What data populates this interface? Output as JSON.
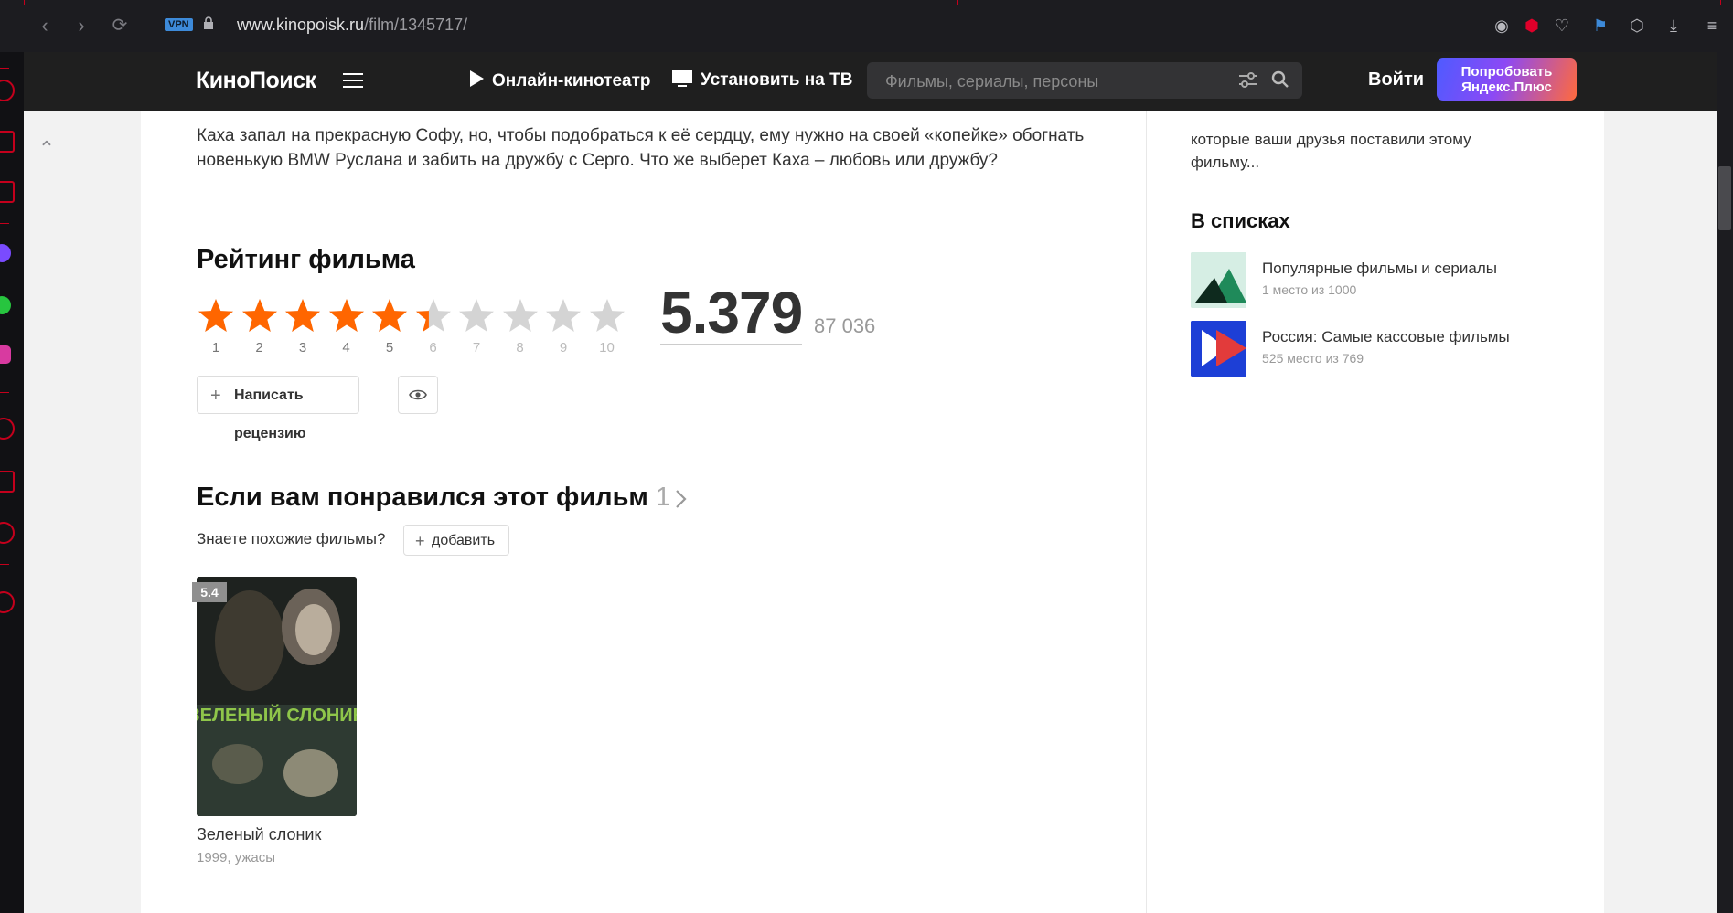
{
  "browser": {
    "vpn_label": "VPN",
    "url_host": "www.kinopoisk.ru",
    "url_path": "/film/1345717/"
  },
  "header": {
    "logo": "КиноПоиск",
    "online_cinema": "Онлайн-кинотеатр",
    "install_tv": "Установить на ТВ",
    "search_placeholder": "Фильмы, сериалы, персоны",
    "login": "Войти",
    "plus_line1": "Попробовать",
    "plus_line2": "Яндекс.Плюс"
  },
  "main": {
    "description": "Каха запал на прекрасную Софу, но, чтобы подобраться к её сердцу, ему нужно на своей «копейке» обогнать новенькую BMW Руслана и забить на дружбу с Серго. Что же выберет Каха – любовь или дружбу?",
    "rating_title": "Рейтинг фильма",
    "rating_value": "5.379",
    "rating_fraction": 0.5379,
    "votes": "87 036",
    "star_labels": [
      "1",
      "2",
      "3",
      "4",
      "5",
      "6",
      "7",
      "8",
      "9",
      "10"
    ],
    "write_review": "Написать рецензию",
    "similar_title": "Если вам понравился этот фильм",
    "similar_count": "1",
    "similar_question": "Знаете похожие фильмы?",
    "add_label": "добавить",
    "similar_film": {
      "rating": "5.4",
      "title": "Зеленый слоник",
      "meta": "1999, ужасы",
      "poster_text": "ЗЕЛЕНЫЙ СЛОНИК"
    }
  },
  "sidebar": {
    "partial_text": "которые ваши друзья поставили этому фильму...",
    "lists_title": "В списках",
    "lists": [
      {
        "title": "Популярные фильмы и сериалы",
        "sub": "1 место из 1000"
      },
      {
        "title": "Россия: Самые кассовые фильмы",
        "sub": "525 место из 769"
      }
    ]
  },
  "colors": {
    "star_active": "#f60",
    "star_inactive": "#d4d4d4"
  }
}
